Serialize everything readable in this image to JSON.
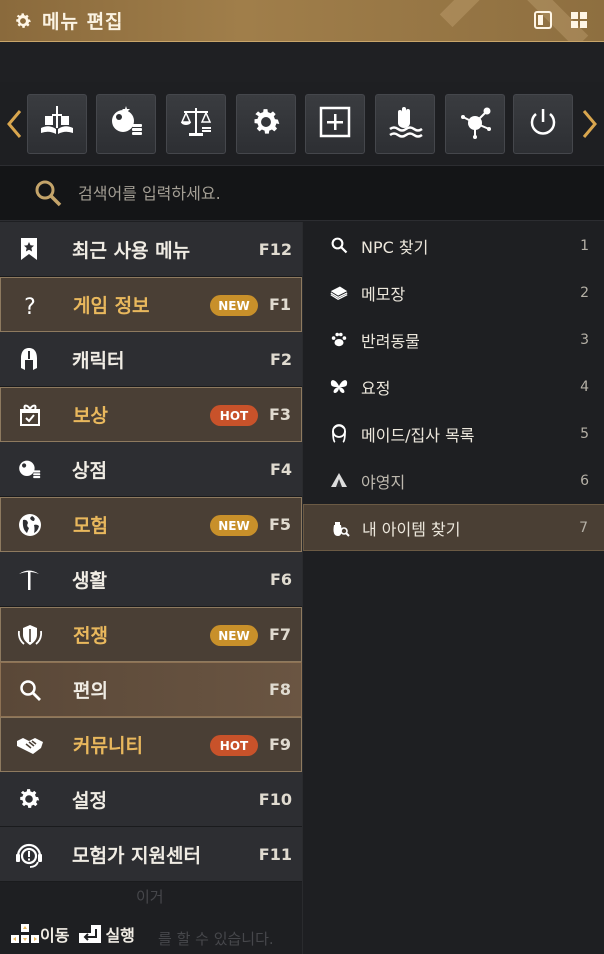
{
  "window": {
    "title": "메뉴 편집"
  },
  "iconbar": {
    "tiles": [
      "book-sword-icon",
      "shop-coins-icon",
      "scales-icon",
      "gear-icon",
      "plus-box-icon",
      "hand-waves-icon",
      "molecule-icon",
      "power-icon"
    ]
  },
  "search": {
    "placeholder": "검색어를 입력하세요."
  },
  "menu": {
    "items": [
      {
        "label": "최근 사용 메뉴",
        "key": "F12",
        "icon": "bookmark-star-icon",
        "badge": ""
      },
      {
        "label": "게임 정보",
        "key": "F1",
        "icon": "question-icon",
        "badge": "NEW"
      },
      {
        "label": "캐릭터",
        "key": "F2",
        "icon": "helmet-icon",
        "badge": ""
      },
      {
        "label": "보상",
        "key": "F3",
        "icon": "gift-box-icon",
        "badge": "HOT"
      },
      {
        "label": "상점",
        "key": "F4",
        "icon": "shop-coins-icon",
        "badge": ""
      },
      {
        "label": "모험",
        "key": "F5",
        "icon": "globe-icon",
        "badge": "NEW"
      },
      {
        "label": "생활",
        "key": "F6",
        "icon": "pickaxe-icon",
        "badge": ""
      },
      {
        "label": "전쟁",
        "key": "F7",
        "icon": "shield-swords-icon",
        "badge": "NEW"
      },
      {
        "label": "편의",
        "key": "F8",
        "icon": "search-icon",
        "badge": ""
      },
      {
        "label": "커뮤니티",
        "key": "F9",
        "icon": "handshake-icon",
        "badge": "HOT"
      },
      {
        "label": "설정",
        "key": "F10",
        "icon": "gear-icon",
        "badge": ""
      },
      {
        "label": "모험가 지원센터",
        "key": "F11",
        "icon": "headset-icon",
        "badge": ""
      }
    ]
  },
  "submenu": {
    "items": [
      {
        "label": "NPC 찾기",
        "num": "1",
        "icon": "search-icon"
      },
      {
        "label": "메모장",
        "num": "2",
        "icon": "notebook-icon"
      },
      {
        "label": "반려동물",
        "num": "3",
        "icon": "paw-icon"
      },
      {
        "label": "요정",
        "num": "4",
        "icon": "butterfly-icon"
      },
      {
        "label": "메이드/집사 목록",
        "num": "5",
        "icon": "maid-icon"
      },
      {
        "label": "야영지",
        "num": "6",
        "icon": "tent-icon"
      },
      {
        "label": "내 아이템 찾기",
        "num": "7",
        "icon": "bag-search-icon"
      }
    ]
  },
  "footer": {
    "move_label": "이동",
    "execute_label": "실행",
    "ghost_line1": "이거",
    "ghost_line2": "를 할 수 있습니다."
  },
  "colors": {
    "accent_gold": "#e9b85d",
    "badge_new": "#c8902a",
    "badge_hot": "#c8522a",
    "titlebar": "#8a6a3c"
  }
}
